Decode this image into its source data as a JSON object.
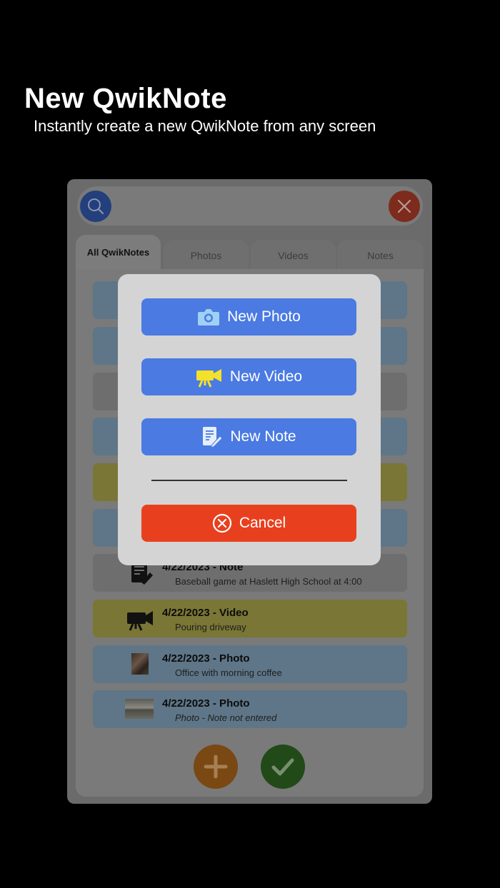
{
  "promo": {
    "title": "New QwikNote",
    "subtitle": "Instantly create a new QwikNote from any screen"
  },
  "tabs": [
    {
      "label": "All QwikNotes",
      "active": true
    },
    {
      "label": "Photos",
      "active": false
    },
    {
      "label": "Videos",
      "active": false
    },
    {
      "label": "Notes",
      "active": false
    }
  ],
  "list": {
    "items": [
      {
        "type": "photo",
        "title": "",
        "desc": ""
      },
      {
        "type": "photo",
        "title": "",
        "desc": ""
      },
      {
        "type": "note",
        "title": "",
        "desc": ""
      },
      {
        "type": "photo",
        "title": "",
        "desc": ""
      },
      {
        "type": "video",
        "title": "",
        "desc": ""
      },
      {
        "type": "photo",
        "title": "",
        "desc": ""
      },
      {
        "type": "note",
        "title": "4/22/2023 - Note",
        "desc": "Baseball game at Haslett High School at 4:00"
      },
      {
        "type": "video",
        "title": "4/22/2023 - Video",
        "desc": "Pouring driveway"
      },
      {
        "type": "photo",
        "title": "4/22/2023 - Photo",
        "desc": "Office with morning coffee"
      },
      {
        "type": "photo",
        "title": "4/22/2023 - Photo",
        "desc": "Photo - Note not entered"
      }
    ]
  },
  "modal": {
    "new_photo": "New Photo",
    "new_video": "New Video",
    "new_note": "New Note",
    "cancel": "Cancel"
  },
  "colors": {
    "modal_button_blue": "#4a7ae2",
    "cancel_red": "#e8401e",
    "icon_photo": "#9fd0f5",
    "icon_video": "#f5e12a",
    "row_photo": "#5e7687",
    "row_video": "#7a7635",
    "row_note": "#6e6e6e"
  }
}
